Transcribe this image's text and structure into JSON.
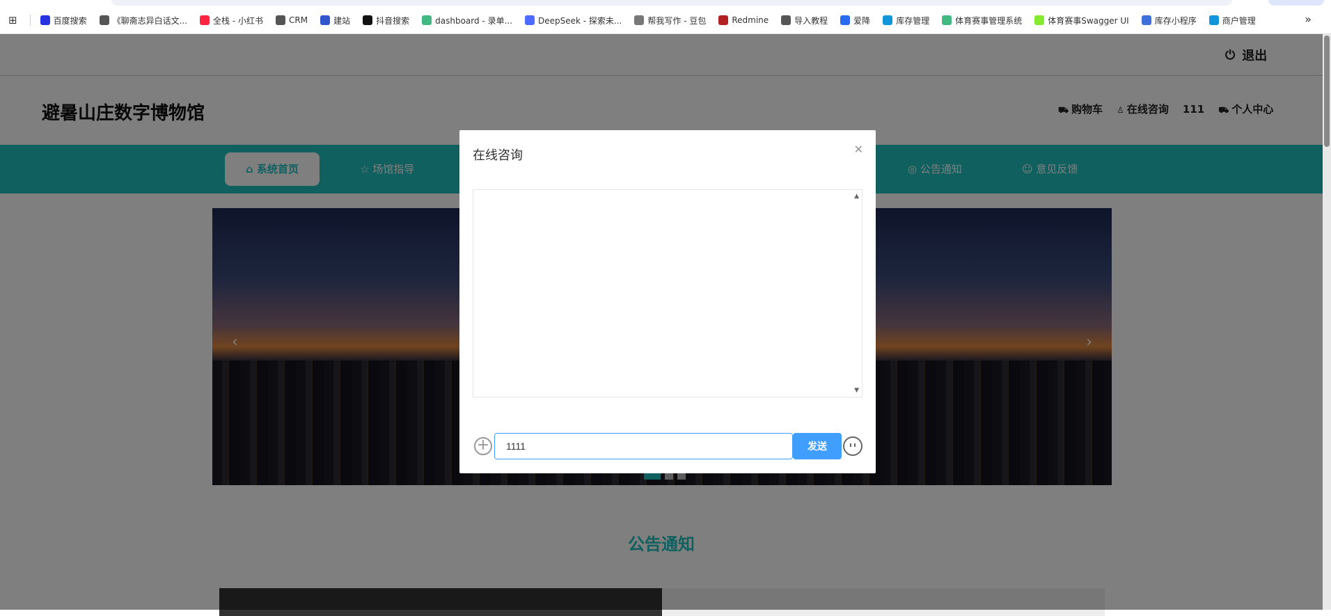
{
  "bookmarks": [
    {
      "label": "百度搜索",
      "color": "#2932e1"
    },
    {
      "label": "《聊斋志异白话文...",
      "color": "#555"
    },
    {
      "label": "全栈 - 小红书",
      "color": "#ff2442"
    },
    {
      "label": "CRM",
      "color": "#555"
    },
    {
      "label": "建站",
      "color": "#3355cc"
    },
    {
      "label": "抖音搜索",
      "color": "#111"
    },
    {
      "label": "dashboard - 录单...",
      "color": "#42b883"
    },
    {
      "label": "DeepSeek - 探索未...",
      "color": "#4d6bfe"
    },
    {
      "label": "帮我写作 - 豆包",
      "color": "#777"
    },
    {
      "label": "Redmine",
      "color": "#b32024"
    },
    {
      "label": "导入教程",
      "color": "#555"
    },
    {
      "label": "爱降",
      "color": "#2a6cf0"
    },
    {
      "label": "库存管理",
      "color": "#1296db"
    },
    {
      "label": "体育赛事管理系统",
      "color": "#42b883"
    },
    {
      "label": "体育赛事Swagger UI",
      "color": "#85ea2d"
    },
    {
      "label": "库存小程序",
      "color": "#3f6fd8"
    },
    {
      "label": "商户管理",
      "color": "#1296db"
    }
  ],
  "header": {
    "logout": "退出",
    "title": "避暑山庄数字博物馆",
    "links": [
      {
        "label": "购物车",
        "icon": "truck-icon"
      },
      {
        "label": "在线咨询",
        "icon": "user-icon"
      },
      {
        "label": "111",
        "icon": ""
      },
      {
        "label": "个人中心",
        "icon": "truck-icon"
      }
    ]
  },
  "nav": [
    {
      "label": "系统首页",
      "icon": "⌂"
    },
    {
      "label": "场馆指导",
      "icon": "☆"
    },
    {
      "label": "公告通知",
      "icon": "◎"
    },
    {
      "label": "意见反馈",
      "icon": "☺"
    }
  ],
  "section_title": "公告通知",
  "modal": {
    "title": "在线咨询",
    "input_value": "1111",
    "send": "发送"
  },
  "colors": {
    "teal": "#20c0c0",
    "primary": "#409eff"
  }
}
